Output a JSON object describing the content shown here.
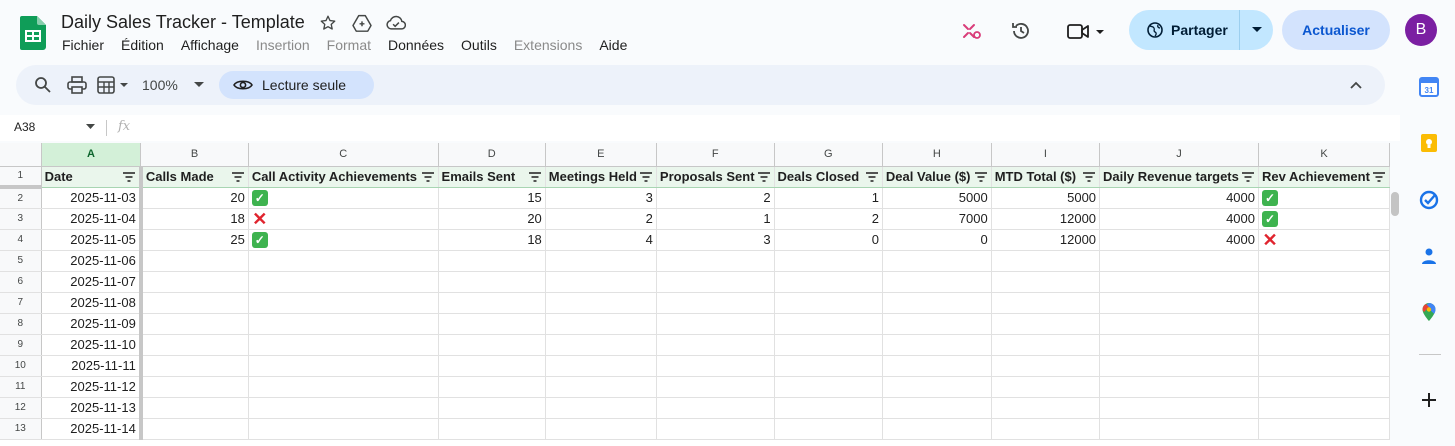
{
  "document": {
    "title": "Daily Sales Tracker - Template",
    "menu": [
      {
        "label": "Fichier",
        "disabled": false
      },
      {
        "label": "Édition",
        "disabled": false
      },
      {
        "label": "Affichage",
        "disabled": false
      },
      {
        "label": "Insertion",
        "disabled": true
      },
      {
        "label": "Format",
        "disabled": true
      },
      {
        "label": "Données",
        "disabled": false
      },
      {
        "label": "Outils",
        "disabled": false
      },
      {
        "label": "Extensions",
        "disabled": true
      },
      {
        "label": "Aide",
        "disabled": false
      }
    ]
  },
  "header": {
    "share_label": "Partager",
    "update_label": "Actualiser",
    "avatar_initial": "B"
  },
  "toolbar": {
    "zoom": "100%",
    "readonly_label": "Lecture seule"
  },
  "formula_bar": {
    "cell_ref": "A38",
    "fx": "fx"
  },
  "sheet": {
    "column_letters": [
      "A",
      "B",
      "C",
      "D",
      "E",
      "F",
      "G",
      "H",
      "I",
      "J",
      "K"
    ],
    "headers": [
      "Date",
      "Calls Made",
      "Call Activity Achievements",
      "Emails Sent",
      "Meetings Held",
      "Proposals Sent",
      "Deals Closed",
      "Deal Value ($)",
      "MTD Total ($)",
      "Daily Revenue targets",
      "Rev Achievement"
    ],
    "rows": [
      {
        "n": "2",
        "date": "2025-11-03",
        "calls": "20",
        "call_ach": "check",
        "emails": "15",
        "meetings": "3",
        "proposals": "2",
        "deals": "1",
        "value": "5000",
        "mtd": "5000",
        "target": "4000",
        "rev_ach": "check"
      },
      {
        "n": "3",
        "date": "2025-11-04",
        "calls": "18",
        "call_ach": "cross",
        "emails": "20",
        "meetings": "2",
        "proposals": "1",
        "deals": "2",
        "value": "7000",
        "mtd": "12000",
        "target": "4000",
        "rev_ach": "check"
      },
      {
        "n": "4",
        "date": "2025-11-05",
        "calls": "25",
        "call_ach": "check",
        "emails": "18",
        "meetings": "4",
        "proposals": "3",
        "deals": "0",
        "value": "0",
        "mtd": "12000",
        "target": "4000",
        "rev_ach": "cross"
      },
      {
        "n": "5",
        "date": "2025-11-06"
      },
      {
        "n": "6",
        "date": "2025-11-07"
      },
      {
        "n": "7",
        "date": "2025-11-08"
      },
      {
        "n": "8",
        "date": "2025-11-09"
      },
      {
        "n": "9",
        "date": "2025-11-10"
      },
      {
        "n": "10",
        "date": "2025-11-11"
      },
      {
        "n": "11",
        "date": "2025-11-12"
      },
      {
        "n": "12",
        "date": "2025-11-13"
      },
      {
        "n": "13",
        "date": "2025-11-14"
      }
    ]
  },
  "side_panel": [
    "calendar-icon",
    "keep-icon",
    "tasks-icon",
    "contacts-icon",
    "maps-icon",
    "add-icon"
  ],
  "colors": {
    "accent": "#0b57d0",
    "share_bg": "#c2e7ff",
    "selected_col": "#d3f0d8",
    "check_green": "#3eb34f",
    "cross_red": "#e0242e"
  }
}
